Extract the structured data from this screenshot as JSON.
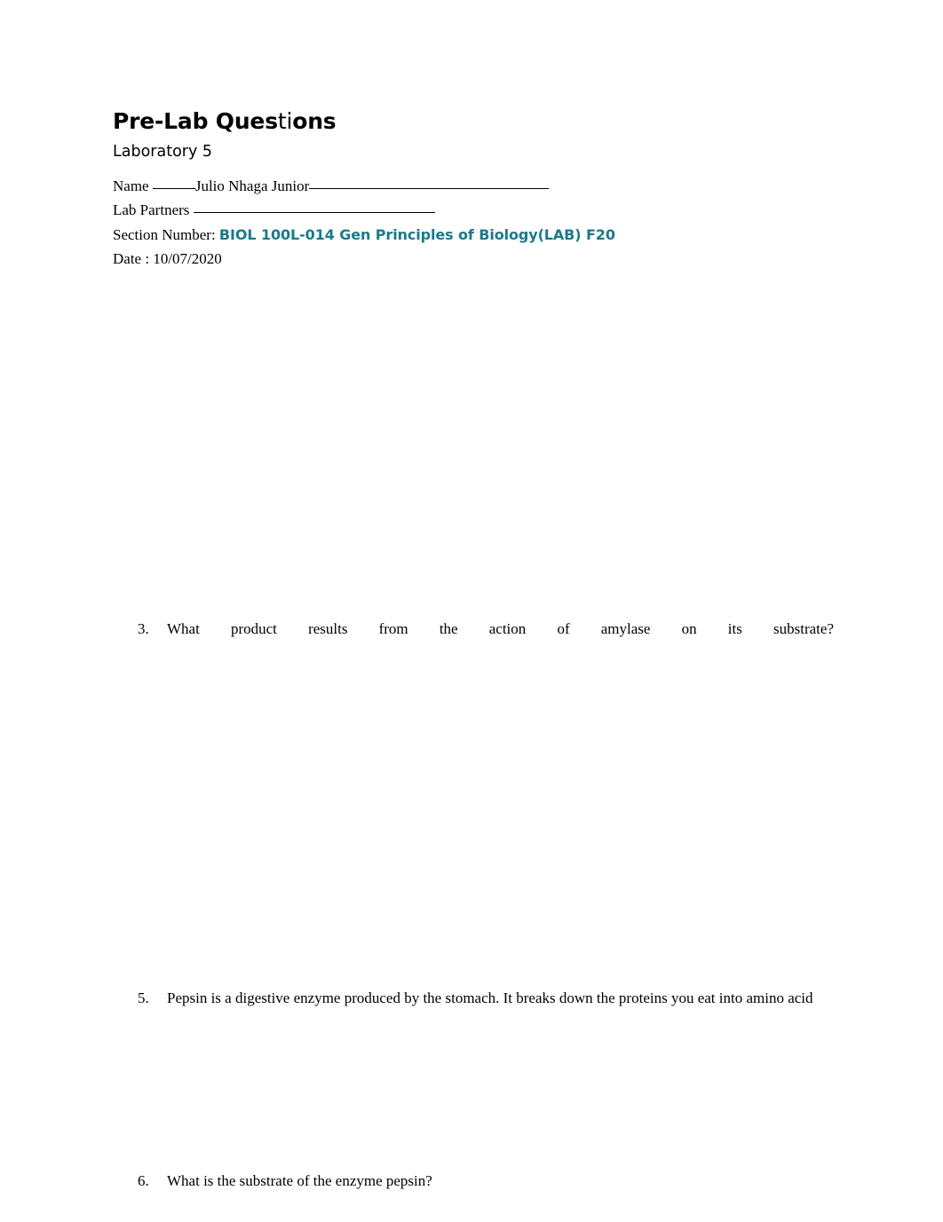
{
  "document": {
    "title": "Pre-Lab Questions",
    "title_part_1": "Pre-Lab Ques",
    "title_part_ligature": "ti",
    "title_part_2": "ons",
    "subtitle": "Laboratory 5"
  },
  "fields": {
    "name_label": "Name ",
    "name_value": "Julio Nhaga Junior",
    "lab_partners_label": "Lab Partners ",
    "lab_partners_value": "",
    "section_label": "Section Number: ",
    "section_value": "BIOL 100L-014 Gen Principles of Biology(LAB) F20",
    "date_label": "Date : ",
    "date_value": "10/07/2020"
  },
  "questions": [
    {
      "number": "3.",
      "text": "What product results from the action of amylase on its substrate?"
    },
    {
      "number": "5.",
      "text": "Pepsin is a digestive enzyme produced by the stomach. It breaks down the proteins you eat into amino acid"
    },
    {
      "number": "6.",
      "text": "What is the substrate of the enzyme pepsin?"
    }
  ],
  "colors": {
    "text": "#000000",
    "accent_teal": "#1b7a8a",
    "page_background": "#ffffff"
  }
}
